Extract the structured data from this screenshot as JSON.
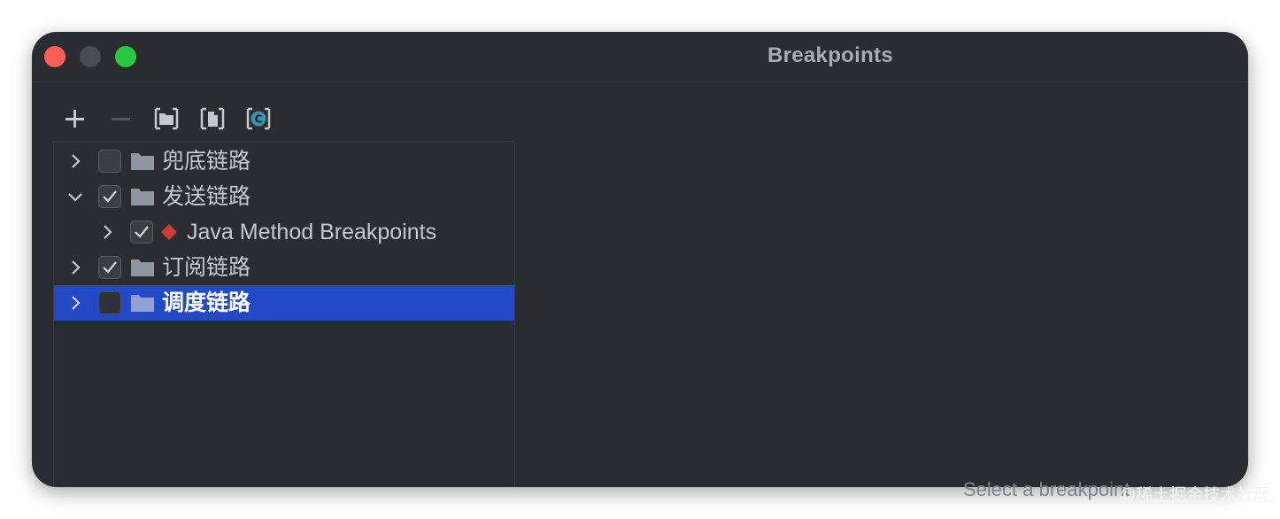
{
  "window": {
    "title": "Breakpoints"
  },
  "toolbar": {
    "buttons": [
      {
        "name": "add-breakpoint-button",
        "icon": "plus-icon"
      },
      {
        "name": "remove-breakpoint-button",
        "icon": "minus-icon"
      },
      {
        "name": "group-by-package-button",
        "icon": "package-group-icon"
      },
      {
        "name": "group-by-file-button",
        "icon": "file-group-icon"
      },
      {
        "name": "group-by-class-button",
        "icon": "class-group-icon"
      }
    ]
  },
  "tree": {
    "rows": [
      {
        "label": "兜底链路",
        "expanded": false,
        "checked": false,
        "selected": false,
        "level": 0,
        "icon": "folder-icon"
      },
      {
        "label": "发送链路",
        "expanded": true,
        "checked": true,
        "selected": false,
        "level": 0,
        "icon": "folder-icon"
      },
      {
        "label": "Java Method Breakpoints",
        "expanded": false,
        "checked": true,
        "selected": false,
        "level": 1,
        "icon": "method-breakpoint-icon"
      },
      {
        "label": "订阅链路",
        "expanded": false,
        "checked": true,
        "selected": false,
        "level": 0,
        "icon": "folder-icon"
      },
      {
        "label": "调度链路",
        "expanded": false,
        "checked": false,
        "selected": true,
        "level": 0,
        "icon": "folder-icon"
      }
    ]
  },
  "detail": {
    "partial_text": "Select a breakpoint"
  },
  "watermark": "@稀土掘金技术社区",
  "colors": {
    "window_bg": "#2b2c2f",
    "selection": "#2349c6",
    "breakpoint_red": "#d23b3b"
  }
}
